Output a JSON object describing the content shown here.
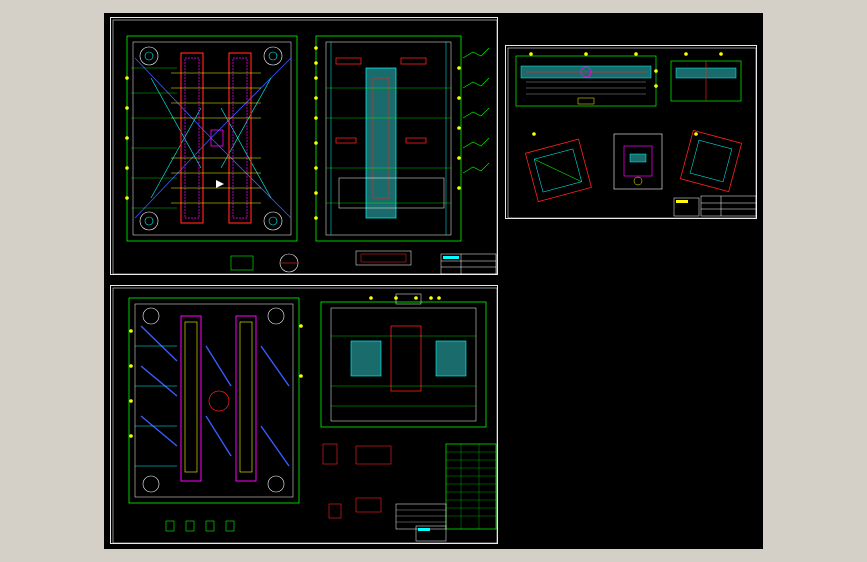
{
  "colors": {
    "background": "#000000",
    "frame": "#e8e8e8",
    "green": "#00ff00",
    "cyan": "#00ffff",
    "red": "#ff2020",
    "magenta": "#ff00ff",
    "yellow": "#ffff00",
    "blue": "#3a5cff",
    "white": "#ffffff",
    "window": "#d4d0c8"
  },
  "icons": {
    "callout": "yellow-circle-balloon"
  }
}
